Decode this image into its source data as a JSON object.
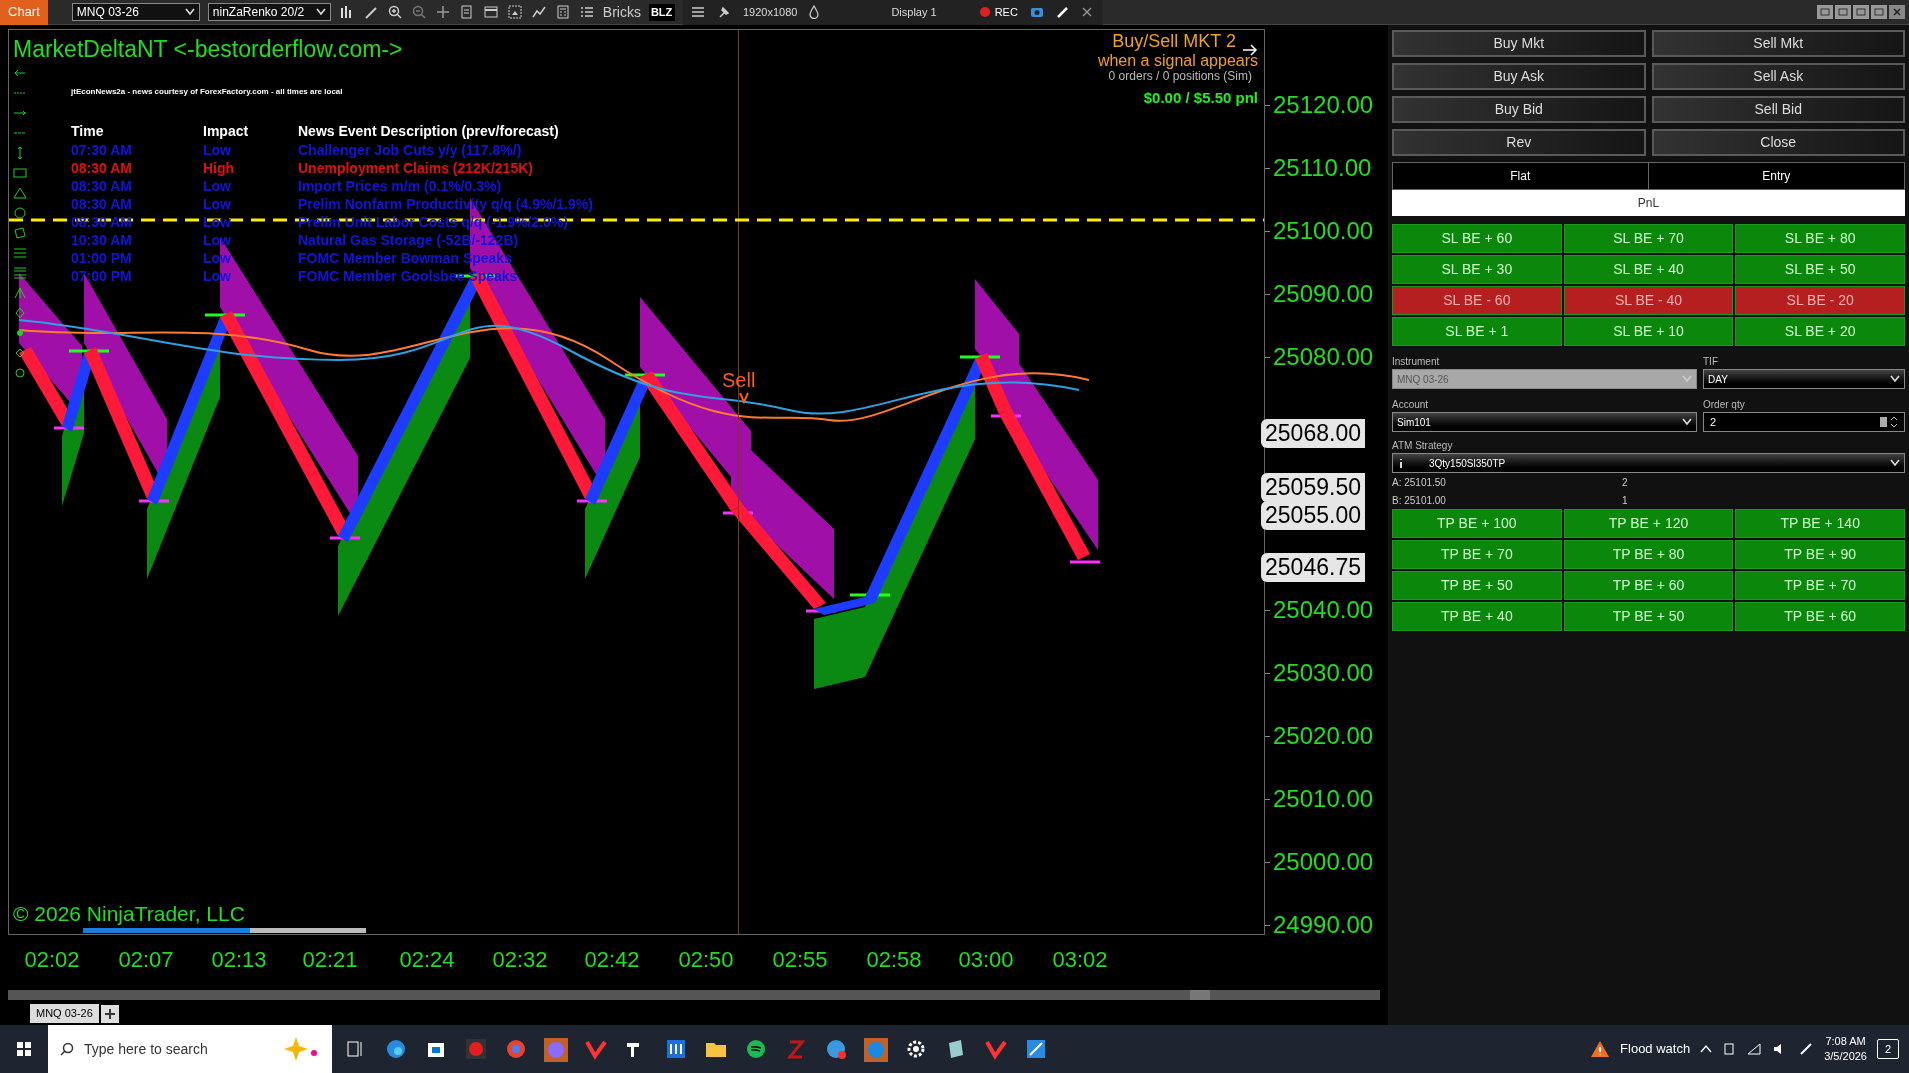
{
  "toolbar": {
    "title": "Chart",
    "instrument": "MNQ 03-26",
    "bar_type": "ninZaRenko 20/2",
    "bricks": "Bricks",
    "template": "BLZ",
    "resolution": "1920x1080",
    "display": "Display 1",
    "rec": "REC"
  },
  "chart": {
    "title": "MarketDeltaNT <-bestorderflow.com->",
    "news_source": "jtEconNews2a - news courtesy of ForexFactory.com - all times are local",
    "news_columns": [
      "Time",
      "Impact",
      "News Event Description (prev/forecast)"
    ],
    "news": [
      {
        "time": "07:30 AM",
        "impact": "Low",
        "description": "Challenger Job Cuts y/y (117.8%/)",
        "color": "#1414d8"
      },
      {
        "time": "08:30 AM",
        "impact": "High",
        "description": "Unemployment Claims (212K/215K)",
        "color": "#e01010"
      },
      {
        "time": "08:30 AM",
        "impact": "Low",
        "description": "Import Prices m/m (0.1%/0.3%)",
        "color": "#1414d8"
      },
      {
        "time": "08:30 AM",
        "impact": "Low",
        "description": "Prelim Nonfarm Productivity q/q (4.9%/1.9%)",
        "color": "#1414d8"
      },
      {
        "time": "08:30 AM",
        "impact": "Low",
        "description": "Prelim Unit Labor Costs q/q (-1.9%/2.0%)",
        "color": "#1414d8"
      },
      {
        "time": "10:30 AM",
        "impact": "Low",
        "description": "Natural Gas Storage (-52B/-122B)",
        "color": "#1414d8"
      },
      {
        "time": "01:00 PM",
        "impact": "Low",
        "description": "FOMC Member Bowman Speaks",
        "color": "#1414d8"
      },
      {
        "time": "07:00 PM",
        "impact": "Low",
        "description": "FOMC Member Goolsbee Speaks",
        "color": "#1414d8"
      }
    ],
    "strategy": "Buy/Sell MKT 2",
    "strategy_note": "when a signal appears",
    "orders": "0 orders / 0 positions (Sim)",
    "pnl": "$0.00 / $5.50 pnl",
    "signal": "Sell",
    "copyright": "© 2026 NinjaTrader, LLC",
    "progress": {
      "level": 0.59
    },
    "price_axis": [
      "25120.00",
      "25110.00",
      "25100.00",
      "25090.00",
      "25080.00",
      "25040.00",
      "25030.00",
      "25020.00",
      "25010.00",
      "25000.00",
      "24990.00"
    ],
    "price_markers": [
      "25068.00",
      "25059.50",
      "25055.00",
      "25046.75"
    ],
    "time_axis": [
      "02:02",
      "02:07",
      "02:13",
      "02:21",
      "02:24",
      "02:32",
      "02:42",
      "02:50",
      "02:55",
      "02:58",
      "03:00",
      "03:02"
    ],
    "tab": "MNQ 03-26"
  },
  "panel": {
    "order_buttons": [
      "Buy Mkt",
      "Sell Mkt",
      "Buy Ask",
      "Sell Ask",
      "Buy Bid",
      "Sell Bid",
      "Rev",
      "Close"
    ],
    "flat": "Flat",
    "entry": "Entry",
    "pnl": "PnL",
    "stop_buttons": [
      {
        "label": "SL BE + 60",
        "color": "#0b870b"
      },
      {
        "label": "SL BE + 70",
        "color": "#0b870b"
      },
      {
        "label": "SL BE + 80",
        "color": "#0b870b"
      },
      {
        "label": "SL BE + 30",
        "color": "#0b870b"
      },
      {
        "label": "SL BE + 40",
        "color": "#0b870b"
      },
      {
        "label": "SL BE + 50",
        "color": "#0b870b"
      },
      {
        "label": "SL BE - 60",
        "color": "#b51f1f"
      },
      {
        "label": "SL BE - 40",
        "color": "#b51f1f"
      },
      {
        "label": "SL BE - 20",
        "color": "#b51f1f"
      },
      {
        "label": "SL BE + 1",
        "color": "#0b870b"
      },
      {
        "label": "SL BE + 10",
        "color": "#0b870b"
      },
      {
        "label": "SL BE + 20",
        "color": "#0b870b"
      }
    ],
    "instrument_label": "Instrument",
    "instrument": {
      "value": "MNQ 03-26",
      "disabled": true
    },
    "tif_label": "TIF",
    "tif": "DAY",
    "account_label": "Account",
    "account": "Sim101",
    "qty_label": "Order qty",
    "qty": "2",
    "atm_label": "ATM Strategy",
    "atm": "3Qty150Sl350TP",
    "ask": {
      "label": "A:",
      "price": "25101.50",
      "size": "2"
    },
    "bid": {
      "label": "B:",
      "price": "25101.00",
      "size": "1"
    },
    "target_buttons": [
      "TP BE + 100",
      "TP BE + 120",
      "TP BE + 140",
      "TP BE + 70",
      "TP BE + 80",
      "TP BE + 90",
      "TP BE + 50",
      "TP BE + 60",
      "TP BE + 70",
      "TP BE + 40",
      "TP BE + 50",
      "TP BE + 60"
    ]
  },
  "taskbar": {
    "search": {
      "placeholder": "Type here to search"
    },
    "weather": "Flood watch",
    "time": "7:08 AM",
    "date": "3/5/2026",
    "notifications": "2"
  }
}
